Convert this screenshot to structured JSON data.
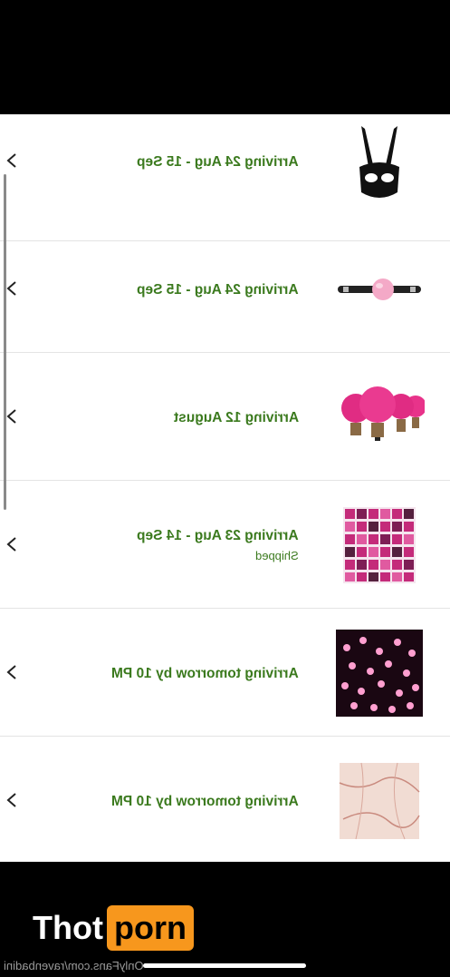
{
  "orders": [
    {
      "status": "Arriving 24 Aug - 15 Sep",
      "substatus": "",
      "icon": "bunny-mask-image"
    },
    {
      "status": "Arriving 24 Aug - 15 Sep",
      "substatus": "",
      "icon": "ball-gag-image"
    },
    {
      "status": "Arriving 12 August",
      "substatus": "",
      "icon": "pink-light-bulbs-image"
    },
    {
      "status": "Arriving 23 Aug - 14 Sep",
      "substatus": "Shipped",
      "icon": "pink-collage-kit-image"
    },
    {
      "status": "Arriving tomorrow by 10 PM",
      "substatus": "",
      "icon": "cherry-blossom-lights-image"
    },
    {
      "status": "Arriving tomorrow by 10 PM",
      "substatus": "",
      "icon": "marble-tapestry-image"
    }
  ],
  "footer": {
    "logo_part1": "Thot",
    "logo_part2": "porn",
    "watermark": "OnlyFans.com/ravenbadini"
  },
  "colors": {
    "status_green": "#3b7a1e",
    "logo_orange": "#f7971d"
  }
}
